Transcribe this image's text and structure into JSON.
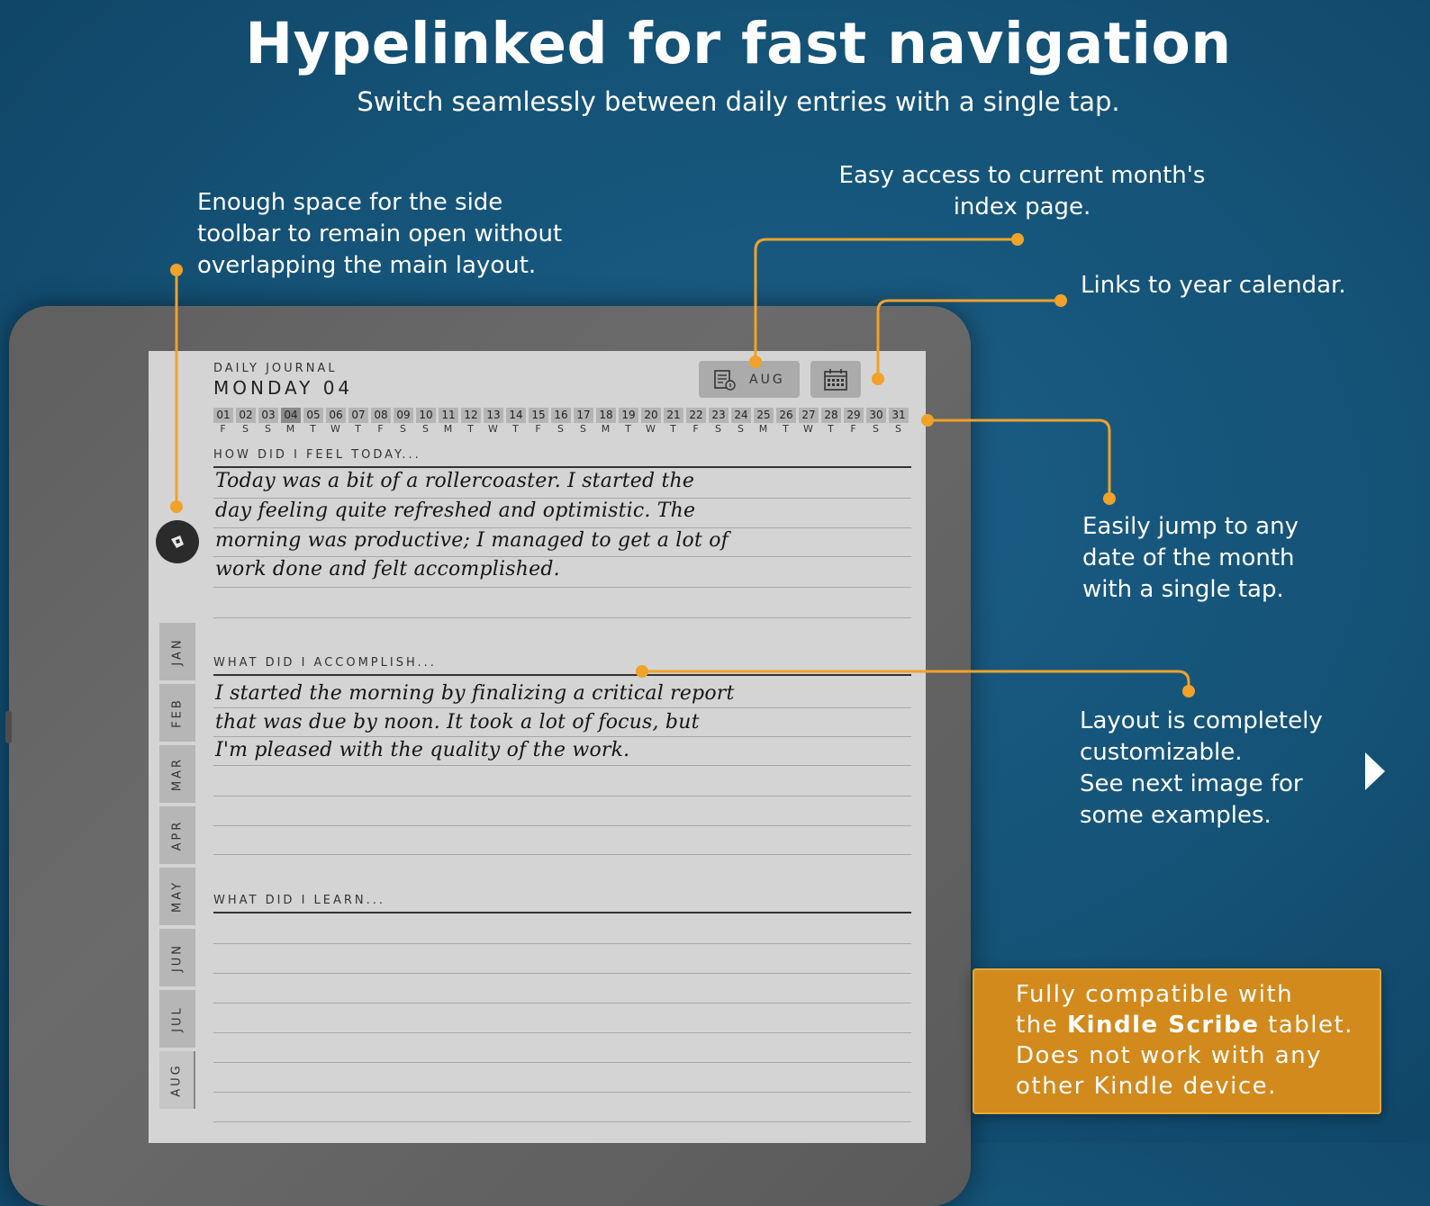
{
  "header": {
    "title": "Hypelinked for fast navigation",
    "subtitle": "Switch seamlessly between daily entries with a single tap."
  },
  "callouts": {
    "side_toolbar": "Enough space for the side\ntoolbar to remain open without\noverlapping the main layout.",
    "month_index": "Easy access to current month's\nindex page.",
    "year_calendar": "Links to year calendar.",
    "jump_date": "Easily jump to any\ndate of the month\nwith a single tap.",
    "layout": "Layout is completely\ncustomizable.\nSee next image for\nsome examples."
  },
  "journal": {
    "label": "DAILY JOURNAL",
    "day": "MONDAY 04",
    "month_button": "AUG",
    "month_icon": "index-page-icon",
    "calendar_icon": "calendar-icon",
    "toolbar_icon": "pen-icon",
    "active_day": "04",
    "days": [
      {
        "n": "01",
        "w": "F"
      },
      {
        "n": "02",
        "w": "S"
      },
      {
        "n": "03",
        "w": "S"
      },
      {
        "n": "04",
        "w": "M"
      },
      {
        "n": "05",
        "w": "T"
      },
      {
        "n": "06",
        "w": "W"
      },
      {
        "n": "07",
        "w": "T"
      },
      {
        "n": "08",
        "w": "F"
      },
      {
        "n": "09",
        "w": "S"
      },
      {
        "n": "10",
        "w": "S"
      },
      {
        "n": "11",
        "w": "M"
      },
      {
        "n": "12",
        "w": "T"
      },
      {
        "n": "13",
        "w": "W"
      },
      {
        "n": "14",
        "w": "T"
      },
      {
        "n": "15",
        "w": "F"
      },
      {
        "n": "16",
        "w": "S"
      },
      {
        "n": "17",
        "w": "S"
      },
      {
        "n": "18",
        "w": "M"
      },
      {
        "n": "19",
        "w": "T"
      },
      {
        "n": "20",
        "w": "W"
      },
      {
        "n": "21",
        "w": "T"
      },
      {
        "n": "22",
        "w": "F"
      },
      {
        "n": "23",
        "w": "S"
      },
      {
        "n": "24",
        "w": "S"
      },
      {
        "n": "25",
        "w": "M"
      },
      {
        "n": "26",
        "w": "T"
      },
      {
        "n": "27",
        "w": "W"
      },
      {
        "n": "28",
        "w": "T"
      },
      {
        "n": "29",
        "w": "F"
      },
      {
        "n": "30",
        "w": "S"
      },
      {
        "n": "31",
        "w": "S"
      }
    ],
    "sections": [
      {
        "label": "HOW DID I FEEL TODAY...",
        "lines": [
          "Today was a bit of a rollercoaster. I started the",
          "day feeling quite refreshed and optimistic. The",
          "morning was productive; I managed to get a lot of",
          "work done and felt accomplished."
        ]
      },
      {
        "label": "WHAT DID I ACCOMPLISH...",
        "lines": [
          "I started the morning by finalizing a critical report",
          "that was due by noon. It took a lot of focus, but",
          "I'm pleased with the quality of the work."
        ]
      },
      {
        "label": "WHAT DID I LEARN...",
        "lines": []
      }
    ],
    "months": [
      "JAN",
      "FEB",
      "MAR",
      "APR",
      "MAY",
      "JUN",
      "JUL",
      "AUG"
    ],
    "active_month": "AUG"
  },
  "promo": {
    "line1": "Fully compatible with",
    "line2_pre": "the ",
    "line2_bold": "Kindle Scribe",
    "line2_post": " tablet.",
    "line3": "Does not work with any",
    "line4": "other Kindle device."
  },
  "colors": {
    "background": "#145276",
    "accent": "#f0a22a",
    "promo": "#d28a1d",
    "screen": "#d4d4d4"
  },
  "next_arrow_icon": "next-arrow-icon"
}
